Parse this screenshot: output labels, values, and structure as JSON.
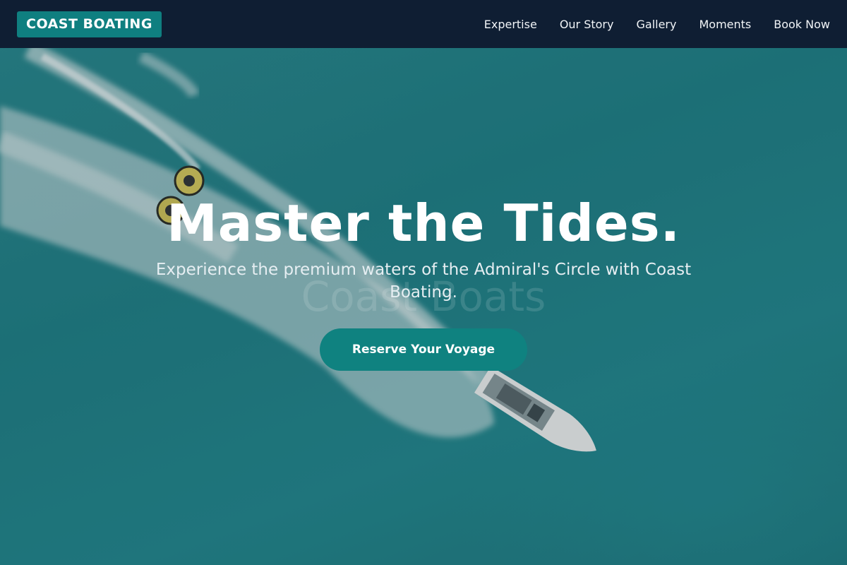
{
  "brand": {
    "name": "COAST BOATING"
  },
  "nav": {
    "items": [
      {
        "label": "Expertise"
      },
      {
        "label": "Our Story"
      },
      {
        "label": "Gallery"
      },
      {
        "label": "Moments"
      },
      {
        "label": "Book Now"
      }
    ]
  },
  "hero": {
    "title": "Master the Tides.",
    "subtitle": "Experience the premium waters of the Admiral's Circle with Coast Boating.",
    "ghost_text": "Coast Boats",
    "cta_label": "Reserve Your Voyage",
    "background_image": "aerial-speedboat-towing-tubes"
  },
  "colors": {
    "header_bg": "#0f1e33",
    "accent": "#0f8280",
    "ocean": "#1f7d82"
  }
}
